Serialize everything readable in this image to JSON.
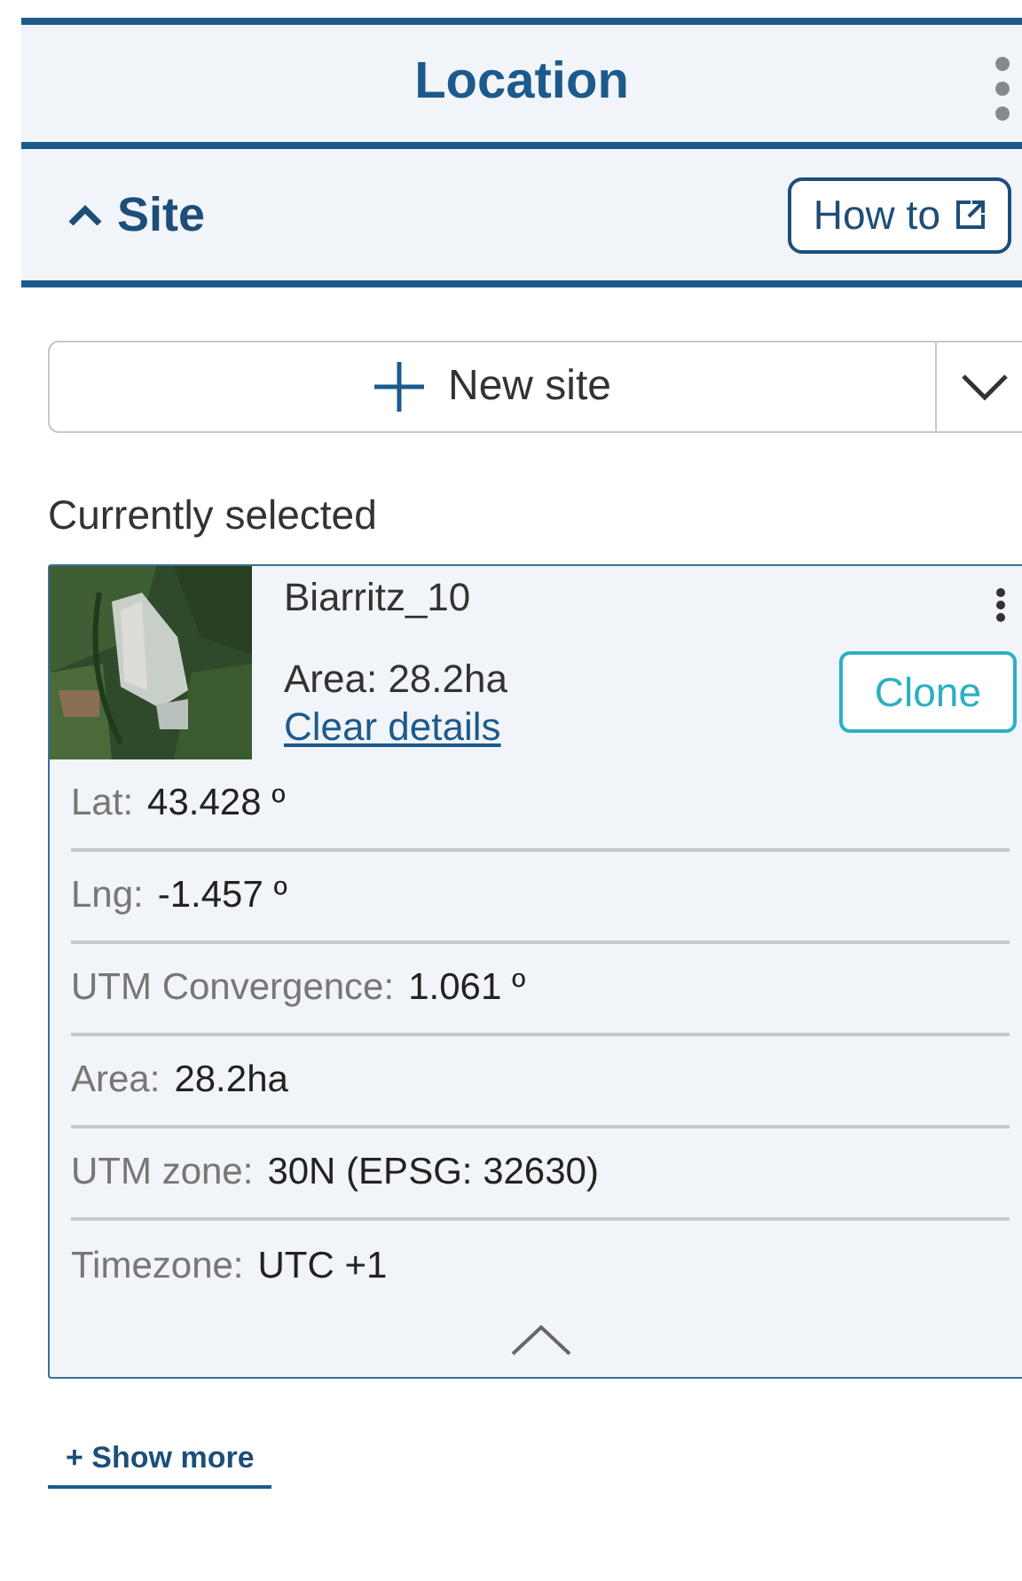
{
  "header": {
    "title": "Location"
  },
  "section": {
    "title": "Site",
    "expanded": true,
    "help_button": "How to"
  },
  "new_site_button": {
    "label": "New site"
  },
  "current_label": "Currently selected",
  "site_card": {
    "name": "Biarritz_10",
    "area": "Area: 28.2ha",
    "clear_link": "Clear details",
    "clone_button": "Clone",
    "expanded": true,
    "details": [
      {
        "label": "Lat:",
        "value": "43.428 º"
      },
      {
        "label": "Lng:",
        "value": "-1.457 º"
      },
      {
        "label": "UTM Convergence:",
        "value": "1.061 º"
      },
      {
        "label": "Area:",
        "value": "28.2ha"
      },
      {
        "label": "UTM zone:",
        "value": "30N (EPSG: 32630)"
      },
      {
        "label": "Timezone:",
        "value": "UTC +1"
      }
    ]
  },
  "show_more_link": "+ Show more"
}
